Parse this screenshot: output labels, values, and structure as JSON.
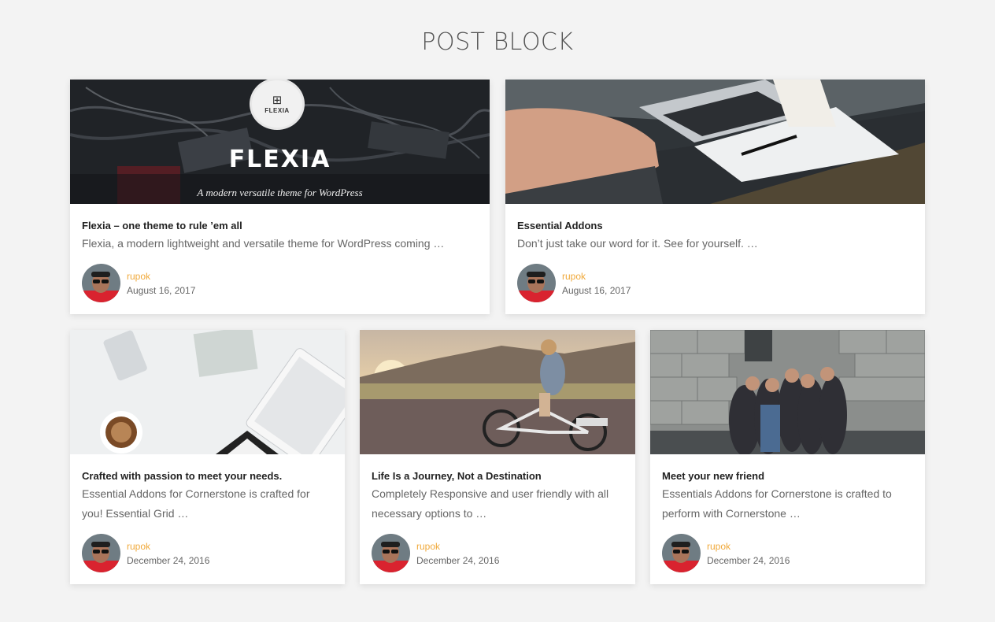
{
  "page": {
    "title": "POST BLOCK"
  },
  "colors": {
    "author": "#f0a93b",
    "background": "#f3f3f3",
    "card": "#ffffff"
  },
  "posts": [
    {
      "title": "Flexia – one theme to rule ’em all",
      "excerpt": "Flexia, a modern lightweight and versatile theme for WordPress coming …",
      "author": "rupok",
      "date": "August 16, 2017",
      "image": {
        "badge_text": "FLEXIA",
        "heading": "FLEXIA",
        "tagline": "A modern versatile theme for WordPress"
      }
    },
    {
      "title": "Essential Addons",
      "excerpt": "Don’t just take our word for it. See for yourself. …",
      "author": "rupok",
      "date": "August 16, 2017"
    },
    {
      "title": "Crafted with passion to meet your needs.",
      "excerpt": "Essential Addons for Cornerstone is crafted for you! Essential Grid …",
      "author": "rupok",
      "date": "December 24, 2016"
    },
    {
      "title": "Life Is a Journey, Not a Destination",
      "excerpt": "Completely Responsive and user friendly with all necessary options to …",
      "author": "rupok",
      "date": "December 24, 2016"
    },
    {
      "title": "Meet your new friend",
      "excerpt": "Essentials Addons for Cornerstone is crafted to perform with Cornerstone …",
      "author": "rupok",
      "date": "December 24, 2016"
    }
  ]
}
